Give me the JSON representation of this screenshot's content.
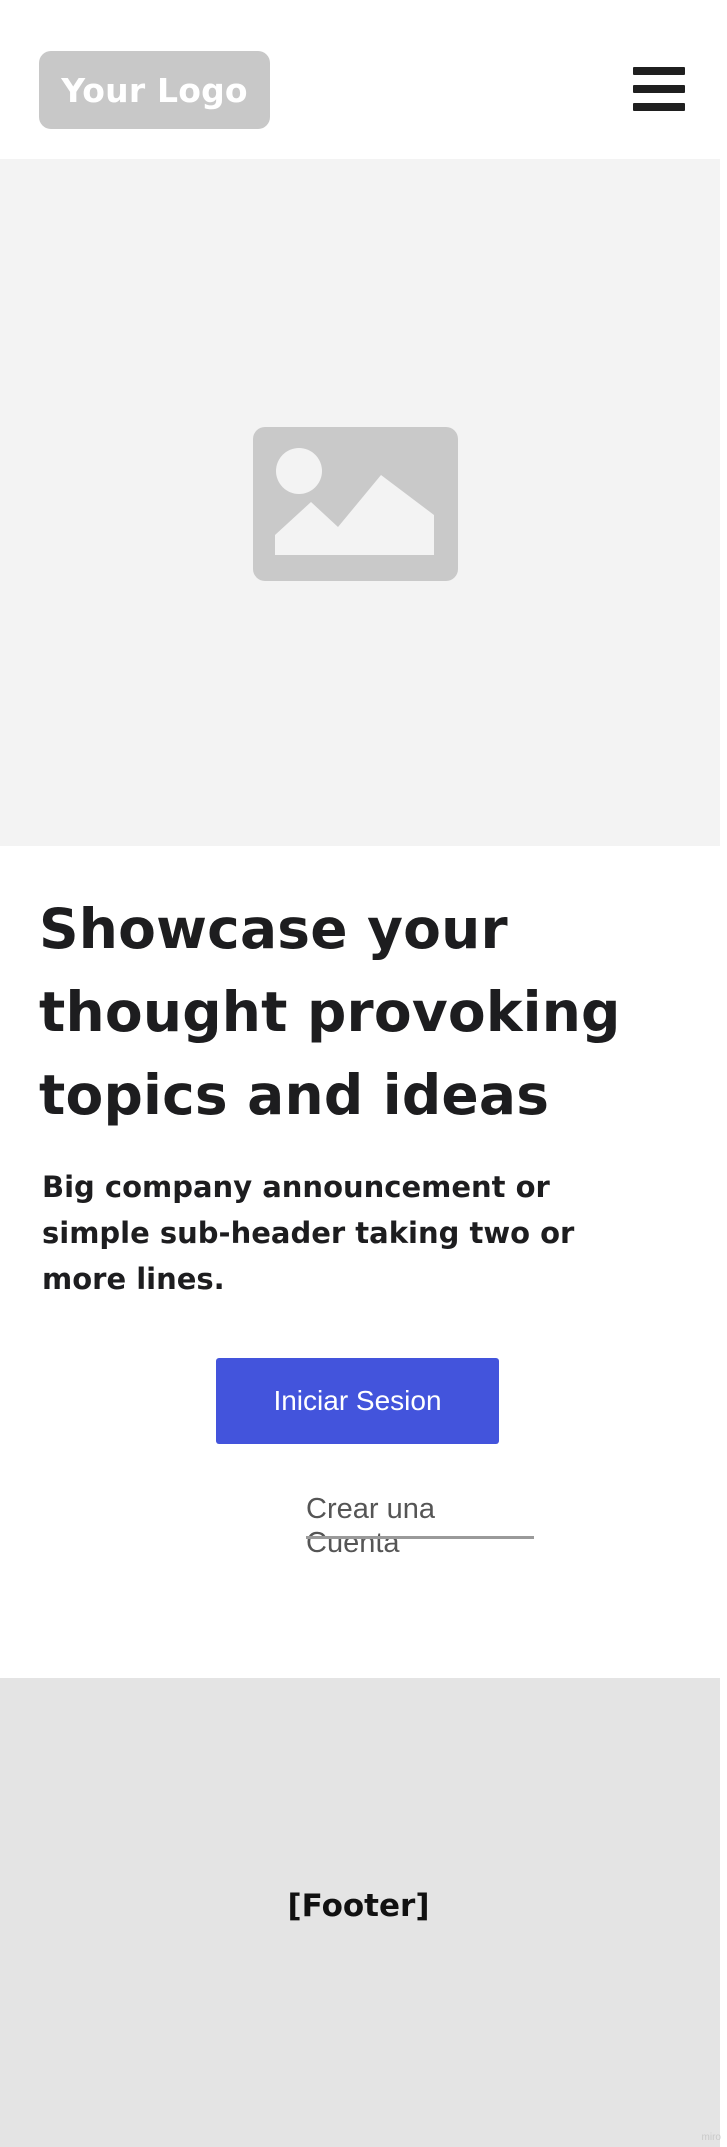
{
  "header": {
    "logo_label": "Your Logo",
    "menu_icon": "hamburger-menu-icon"
  },
  "hero": {
    "image_icon": "image-placeholder-icon"
  },
  "main": {
    "headline": "Showcase your thought provoking topics and ideas",
    "subheader": "Big company announcement or simple sub-header taking two or more lines.",
    "primary_button_label": "Iniciar Sesion",
    "secondary_link_label": "Crear una Cuenta"
  },
  "footer": {
    "label": "[Footer]"
  },
  "watermark": "miro",
  "colors": {
    "primary_button": "#4354dc",
    "hero_background": "#f3f3f3",
    "footer_background": "#e4e4e4",
    "logo_background": "#c8c8c8",
    "text": "#1d1d1f"
  }
}
